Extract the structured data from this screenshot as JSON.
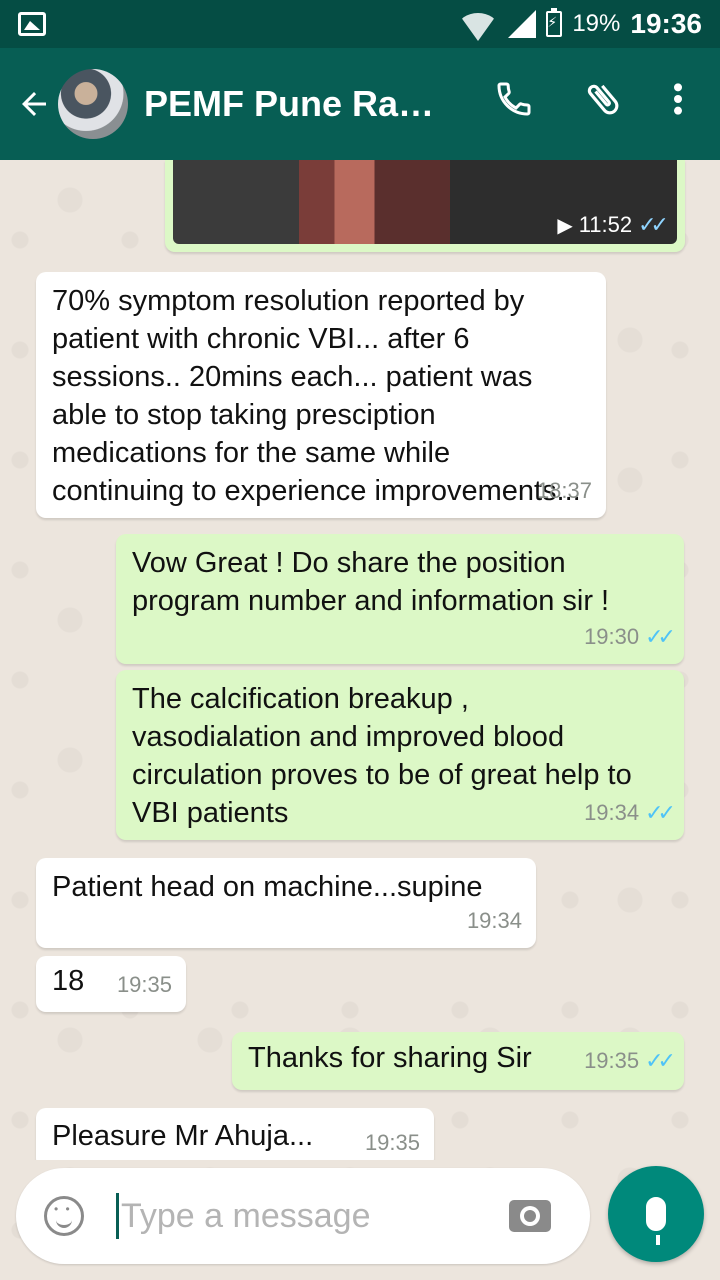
{
  "status_bar": {
    "battery": "19%",
    "time": "19:36"
  },
  "app_bar": {
    "contact_name": "PEMF Pune Rahul Ahuja",
    "icons": [
      "back-arrow-icon",
      "phone-icon",
      "paperclip-icon",
      "more-vert-icon"
    ]
  },
  "messages": [
    {
      "dir": "out",
      "kind": "image",
      "time": "11:52"
    },
    {
      "dir": "in",
      "text": "70% symptom resolution reported by patient with chronic VBI... after 6 sessions.. 20mins each... patient was able to stop taking presciption medications for the same while continuing to experience improvements...",
      "time": "18:37"
    },
    {
      "dir": "out",
      "text": "Vow Great ! Do share the position program number and information sir !",
      "time": "19:30"
    },
    {
      "dir": "out",
      "text": "The calcification breakup , vasodialation and improved blood circulation proves to be of great help to VBI patients",
      "time": "19:34"
    },
    {
      "dir": "in",
      "text": "Patient head on machine...supine",
      "time": "19:34"
    },
    {
      "dir": "in",
      "text": "18",
      "time": "19:35"
    },
    {
      "dir": "out",
      "text": "Thanks for sharing Sir",
      "time": "19:35"
    },
    {
      "dir": "in",
      "text": "Pleasure Mr Ahuja...",
      "time": "19:35"
    }
  ],
  "composer": {
    "placeholder": "Type a message"
  },
  "colors": {
    "status_bar": "#054d44",
    "app_bar": "#075e54",
    "outgoing_bubble": "#dcf8c6",
    "incoming_bubble": "#ffffff",
    "read_ticks": "#4fc3f7",
    "fab": "#00897b"
  }
}
